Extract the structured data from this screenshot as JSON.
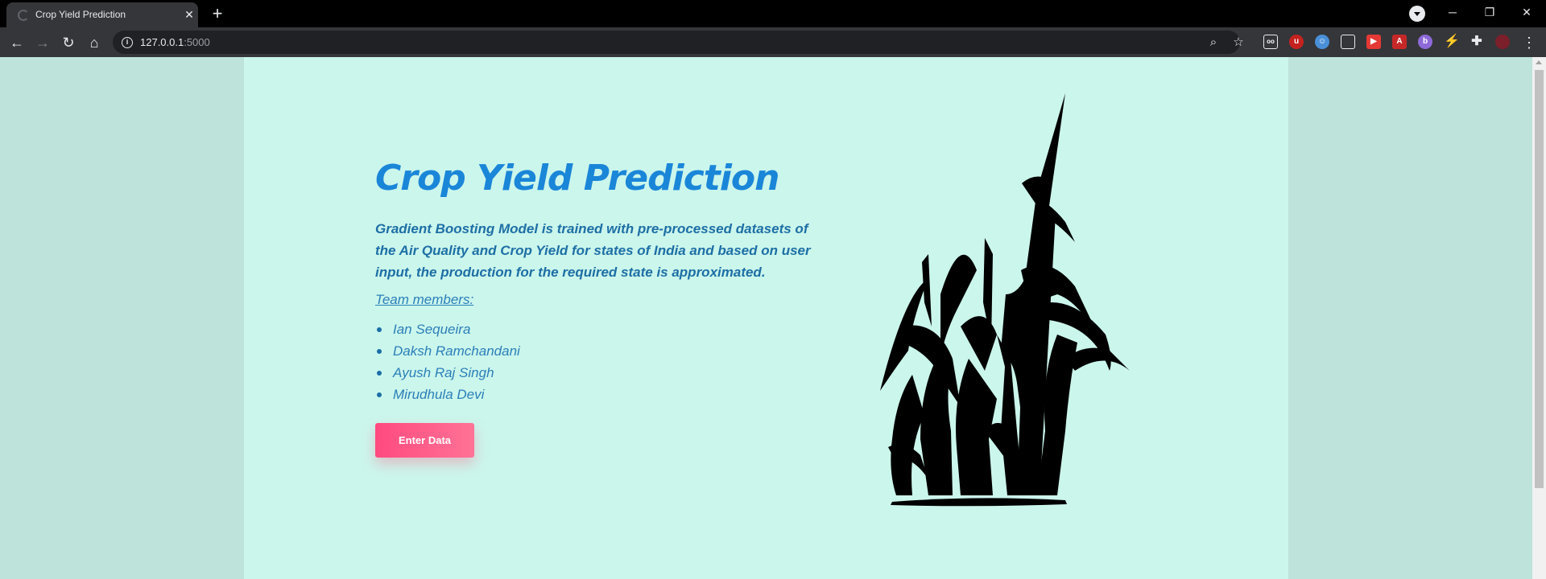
{
  "browser": {
    "tab_title": "Crop Yield Prediction",
    "tab_close": "✕",
    "new_tab": "+",
    "url_host": "127.0.0.1",
    "url_port": ":5000",
    "window_controls": {
      "minimize": "─",
      "restore": "❐",
      "close": "✕"
    },
    "extensions": [
      "uBlock Origin",
      "extension",
      "picture-in-picture",
      "video",
      "acrobat",
      "bing",
      "bolt",
      "puzzle"
    ]
  },
  "hero": {
    "title": "Crop Yield Prediction",
    "description": "Gradient Boosting Model is trained with pre-processed datasets of the Air Quality and Crop Yield for states of India and based on user input, the production for the required state is approximated.",
    "team_heading": "Team members:",
    "team_members": [
      "Ian Sequeira",
      "Daksh Ramchandani",
      "Ayush Raj Singh",
      "Mirudhula Devi"
    ],
    "cta_label": "Enter Data"
  },
  "colors": {
    "page_bg": "#cbf6ec",
    "side_bg": "#bde3da",
    "title_color": "#1a86d8",
    "button_gradient": [
      "#ff4a7f",
      "#ff7296"
    ]
  }
}
